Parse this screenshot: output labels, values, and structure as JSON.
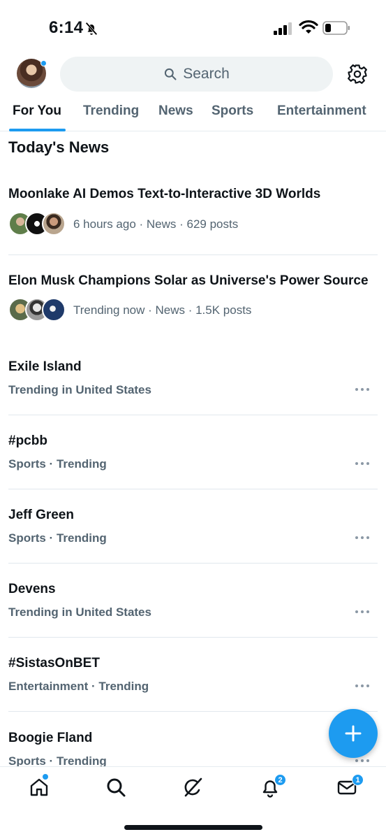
{
  "status_bar": {
    "time": "6:14"
  },
  "header": {
    "search_placeholder": "Search"
  },
  "tabs": [
    {
      "label": "For You",
      "active": true
    },
    {
      "label": "Trending",
      "active": false
    },
    {
      "label": "News",
      "active": false
    },
    {
      "label": "Sports",
      "active": false
    },
    {
      "label": "Entertainment",
      "active": false
    }
  ],
  "section": {
    "title": "Today's News"
  },
  "news": [
    {
      "title": "Moonlake AI Demos Text-to-Interactive 3D Worlds",
      "meta": "6 hours ago · News · 629 posts"
    },
    {
      "title": "Elon Musk Champions Solar as Universe's Power Source",
      "meta": "Trending now · News · 1.5K posts"
    }
  ],
  "trends": [
    {
      "title": "Exile Island",
      "subtitle": "Trending in United States"
    },
    {
      "title": "#pcbb",
      "subtitle": "Sports · Trending"
    },
    {
      "title": "Jeff Green",
      "subtitle": "Sports · Trending"
    },
    {
      "title": "Devens",
      "subtitle": "Trending in United States"
    },
    {
      "title": "#SistasOnBET",
      "subtitle": "Entertainment · Trending"
    },
    {
      "title": "Boogie Fland",
      "subtitle": "Sports · Trending"
    }
  ],
  "bottom_nav": {
    "items": [
      "home-icon",
      "search-icon",
      "grok-icon",
      "bell-icon",
      "mail-icon"
    ],
    "notifications_badge": "2",
    "messages_badge": "1"
  },
  "colors": {
    "accent": "#1d9bf0",
    "text": "#0f1419",
    "secondary": "#536471"
  }
}
